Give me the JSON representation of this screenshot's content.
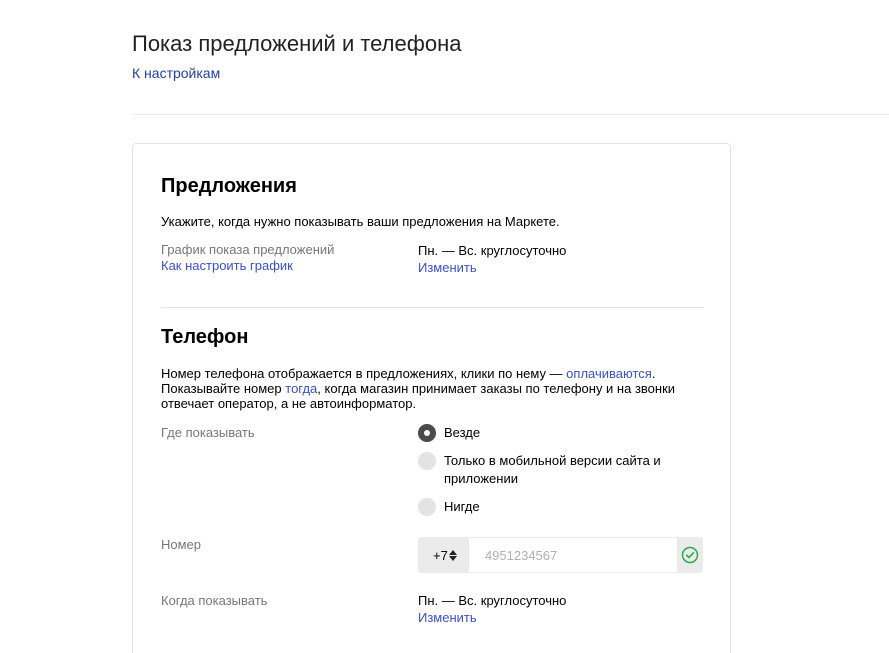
{
  "header": {
    "title": "Показ предложений и телефона",
    "back_link": "К настройкам"
  },
  "offers": {
    "title": "Предложения",
    "description": "Укажите, когда нужно показывать ваши предложения на Маркете.",
    "schedule_label": "График показа предложений",
    "schedule_help_link": "Как настроить график",
    "schedule_value": "Пн. — Вс. круглосуточно",
    "change_link": "Изменить"
  },
  "phone": {
    "title": "Телефон",
    "description_part1": "Номер телефона отображается в предложениях, клики по нему — ",
    "description_link1": "оплачиваются",
    "description_part2": ". Показывайте номер ",
    "description_link2": "тогда",
    "description_part3": ", когда магазин принимает заказы по телефону и на звонки отвечает оператор, а не автоинформатор.",
    "where_label": "Где показывать",
    "where_options": [
      {
        "label": "Везде",
        "checked": true
      },
      {
        "label": "Только в мобильной версии сайта и приложении",
        "checked": false
      },
      {
        "label": "Нигде",
        "checked": false
      }
    ],
    "number_label": "Номер",
    "country_code": "+7",
    "number_placeholder": "4951234567",
    "number_value": "",
    "when_label": "Когда показывать",
    "when_value": "Пн. — Вс. круглосуточно",
    "change_link": "Изменить"
  },
  "icons": {
    "confirm": "check-circle-icon",
    "select": "sort-arrows-icon"
  },
  "colors": {
    "link": "#3b4fd1",
    "back_link": "#1f3fa8",
    "confirm_icon": "#2eaa4a",
    "radio_checked": "#4b4b4b",
    "radio_unchecked": "#e3e3e3"
  }
}
